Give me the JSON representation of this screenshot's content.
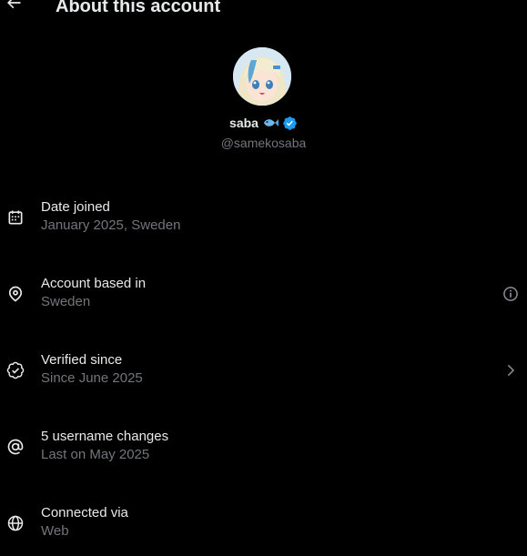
{
  "header": {
    "title": "About this account",
    "back_icon": "arrow-left-icon"
  },
  "profile": {
    "display_name": "saba",
    "name_emoji": "fish-emoji",
    "verified_icon": "verified-badge-icon",
    "handle": "@samekosaba"
  },
  "rows": [
    {
      "title": "Date joined",
      "value": "January 2025, Sweden",
      "icon": "calendar-icon"
    },
    {
      "title": "Account based in",
      "value": "Sweden",
      "icon": "location-pin-icon",
      "action_icon": "info-icon"
    },
    {
      "title": "Verified since",
      "value": "Since June 2025",
      "icon": "verified-check-icon",
      "action_icon": "chevron-right-icon"
    },
    {
      "title": "5 username changes",
      "value": "Last on May 2025",
      "icon": "at-sign-icon"
    },
    {
      "title": "Connected via",
      "value": "Web",
      "icon": "globe-icon"
    }
  ],
  "colors": {
    "background": "#000000",
    "primary_text": "#e7e9ea",
    "secondary_text": "#71767b",
    "verified_blue": "#1d9bf0"
  }
}
